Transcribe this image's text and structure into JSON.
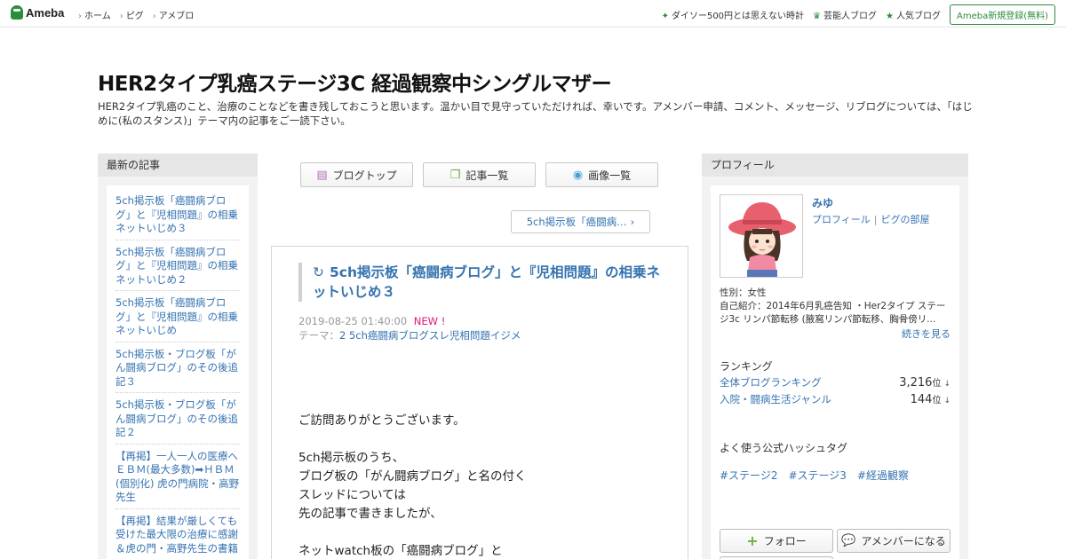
{
  "header": {
    "logo_text": "Ameba",
    "nav": [
      "ホーム",
      "ピグ",
      "アメブロ"
    ],
    "right_links": [
      {
        "icon": "sparkle-icon",
        "label": "ダイソー500円とは思えない時計"
      },
      {
        "icon": "crown-icon",
        "label": "芸能人ブログ"
      },
      {
        "icon": "star-icon",
        "label": "人気ブログ"
      }
    ],
    "signup_label": "Ameba新規登録(無料)"
  },
  "blog": {
    "title": "HER2タイプ乳癌ステージ3C 経過観察中シングルマザー",
    "description": "HER2タイプ乳癌のこと、治療のことなどを書き残しておこうと思います。温かい目で見守っていただければ、幸いです。アメンバー申請、コメント、メッセージ、リブログについては、「はじめに(私のスタンス)」テーマ内の記事をご一読下さい。"
  },
  "left_sidebar": {
    "heading": "最新の記事",
    "items": [
      "5ch掲示板「癌闘病ブログ」と『児相問題』の相乗ネットいじめ３",
      "5ch掲示板「癌闘病ブログ」と『児相問題』の相乗ネットいじめ２",
      "5ch掲示板「癌闘病ブログ」と『児相問題』の相乗ネットいじめ",
      "5ch掲示板・ブログ板「がん闘病ブログ」のその後追記３",
      "5ch掲示板・ブログ板「がん闘病ブログ」のその後追記２",
      "【再掲】一人一人の医療へ ＥＢＭ(最大多数)➡ＨＢＭ(個別化) 虎の門病院・高野先生",
      "【再掲】結果が厳しくても受けた最大限の治療に感謝 ＆虎の門・高野先生の書籍"
    ]
  },
  "center": {
    "buttons": [
      {
        "icon": "notebook-icon",
        "label": "ブログトップ"
      },
      {
        "icon": "documents-icon",
        "label": "記事一覧"
      },
      {
        "icon": "camera-icon",
        "label": "画像一覧"
      }
    ],
    "next_link": "5ch掲示板「癌闘病…",
    "article": {
      "reblog_icon": "↻",
      "title": "5ch掲示板「癌闘病ブログ」と『児相問題』の相乗ネットいじめ３",
      "date": "2019-08-25 01:40:00",
      "new_badge": "NEW !",
      "theme_prefix": "テーマ：",
      "theme": "2 5ch癌闘病ブログスレ児相問題イジメ",
      "body": [
        "ご訪問ありがとうございます。",
        "",
        "5ch掲示板のうち、",
        "ブログ板の「がん闘病ブログ」と名の付く",
        "スレッドについては",
        "先の記事で書きましたが、",
        "",
        "ネットwatch板の「癌闘病ブログ」と"
      ]
    }
  },
  "right_sidebar": {
    "heading": "プロフィール",
    "name": "みゆ",
    "profile_link": "プロフィール",
    "pig_link": "ピグの部屋",
    "gender": "性別：女性",
    "intro": "自己紹介：2014年6月乳癌告知 ・Her2タイプ ステージ3c リンパ節転移 (腋窩リンパ節転移、胸骨傍リ...",
    "more": "続きを見る",
    "ranking_heading": "ランキング",
    "rankings": [
      {
        "label": "全体ブログランキング",
        "value": "3,216",
        "unit": "位",
        "arrow": "↓"
      },
      {
        "label": "入院・闘病生活ジャンル",
        "value": "144",
        "unit": "位",
        "arrow": "↓"
      }
    ],
    "hashtag_heading": "よく使う公式ハッシュタグ",
    "hashtags": [
      "#ステージ2",
      "#ステージ3",
      "#経過観察"
    ],
    "follow_label": "フォロー",
    "amember_label": "アメンバーになる"
  }
}
